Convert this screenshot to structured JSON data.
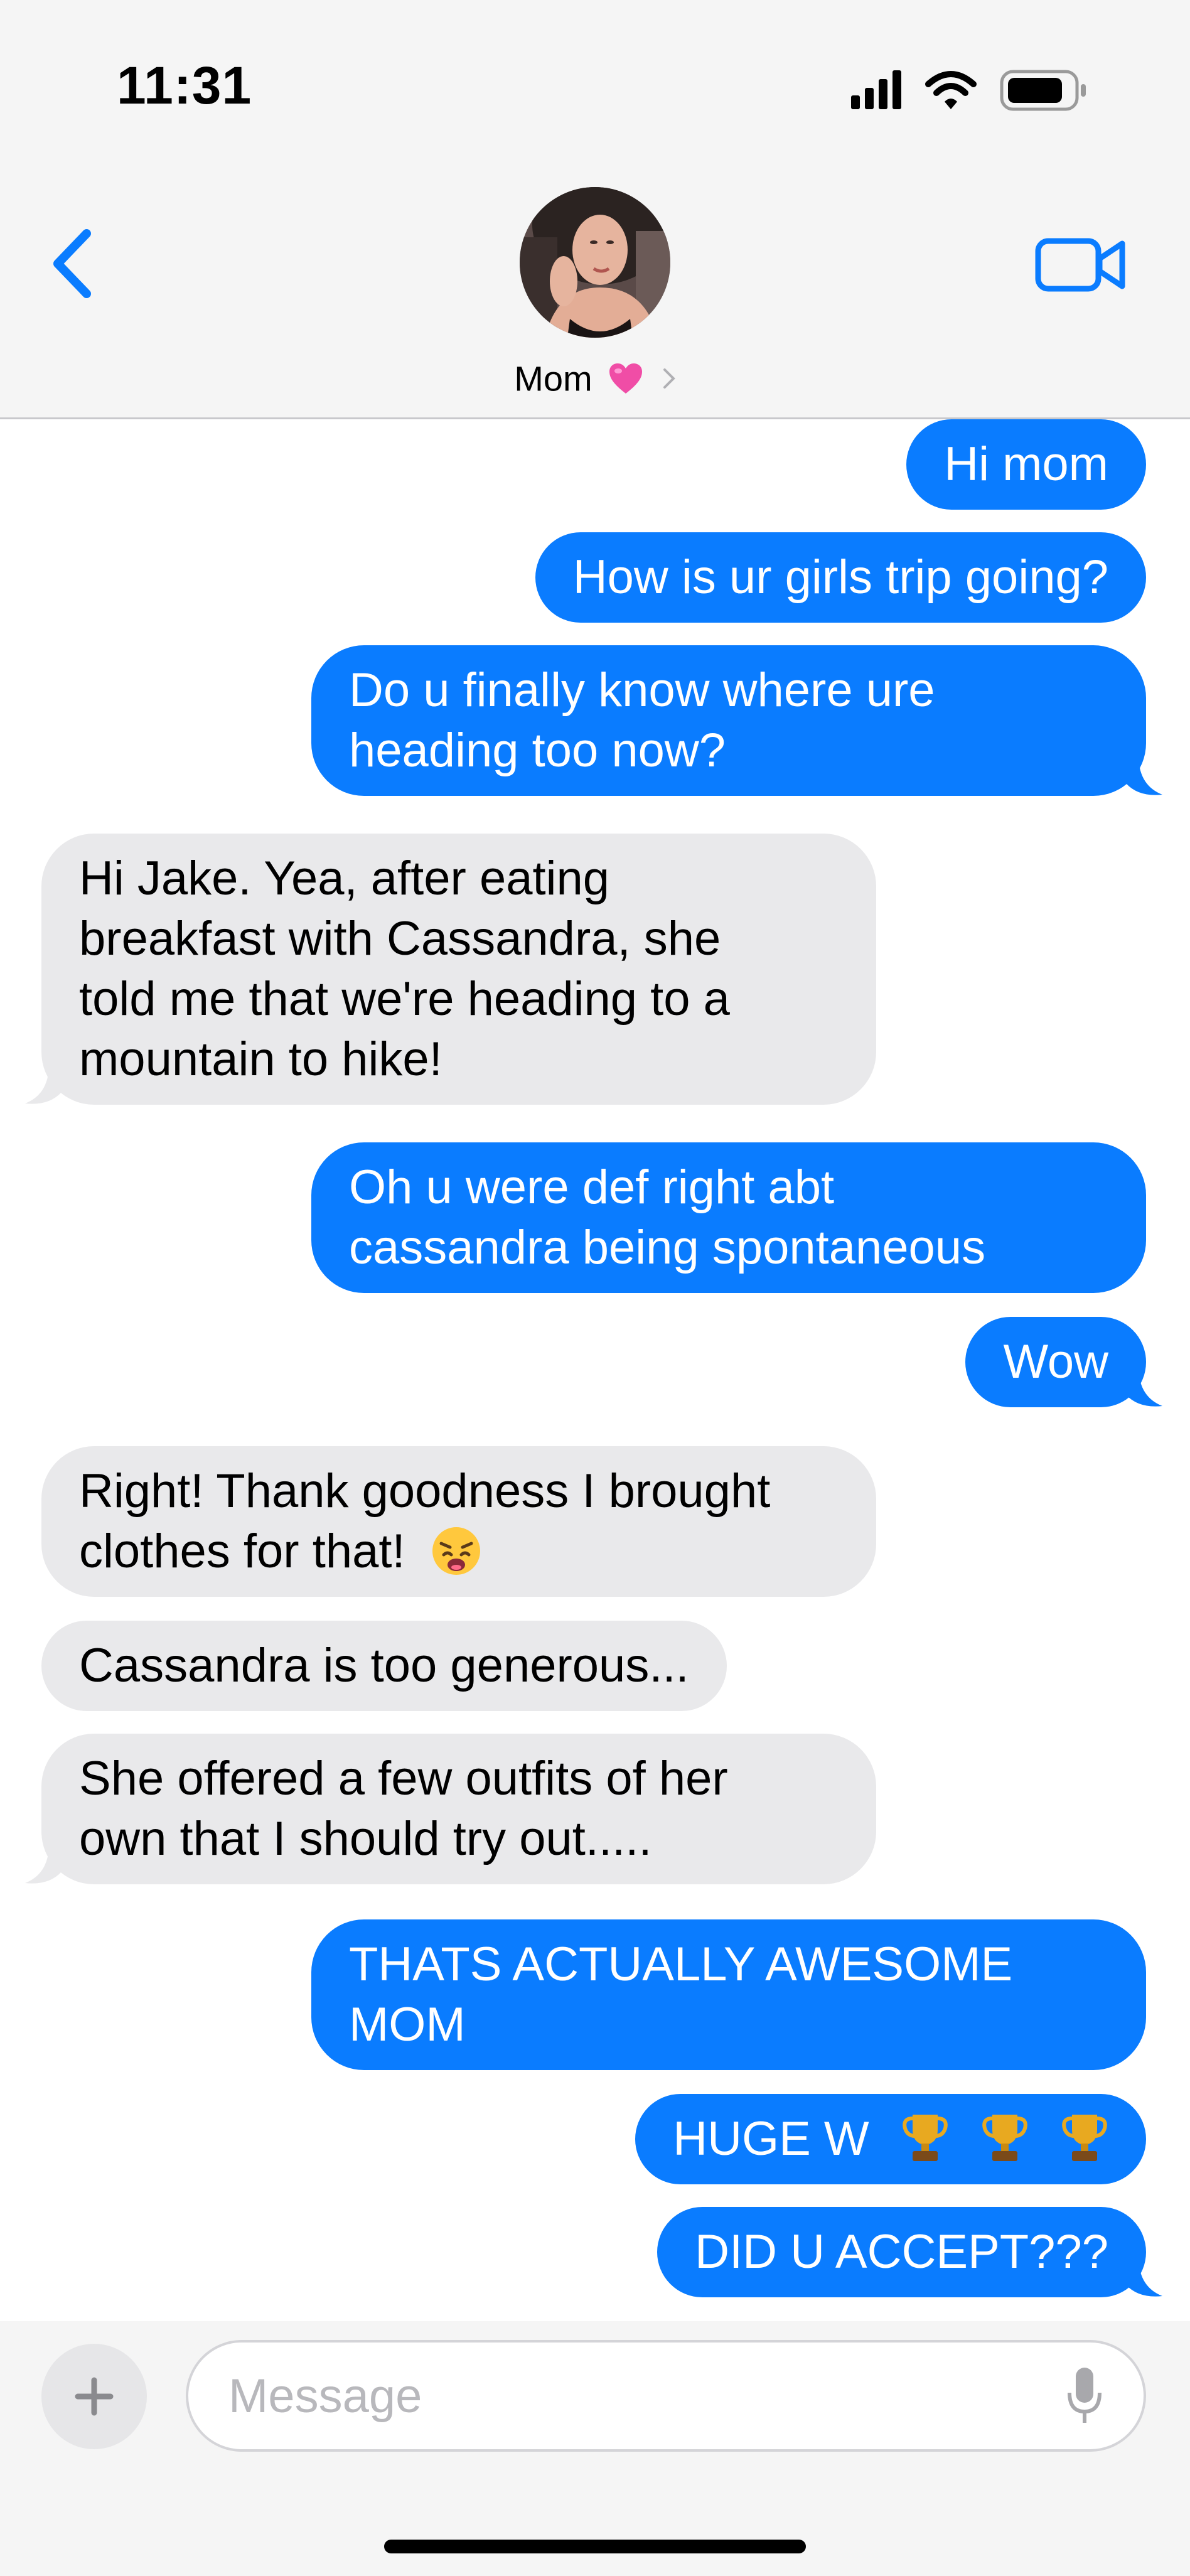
{
  "status_bar": {
    "time": "11:31"
  },
  "header": {
    "contact_name": "Mom",
    "contact_emoji": "heart-emoji",
    "back_icon": "chevron-left-icon",
    "video_icon": "video-camera-icon"
  },
  "messages": [
    {
      "from": "me",
      "lines": [
        "Hi mom"
      ]
    },
    {
      "from": "me",
      "lines": [
        "How is ur girls trip going?"
      ]
    },
    {
      "from": "me",
      "lines": [
        "Do u finally know where ure",
        "heading too now?"
      ]
    },
    {
      "from": "them",
      "lines": [
        "Hi Jake. Yea, after eating",
        "breakfast with Cassandra, she",
        "told me that we're heading to a",
        "mountain to hike!"
      ]
    },
    {
      "from": "me",
      "lines": [
        "Oh u were def right abt",
        "cassandra being spontaneous"
      ]
    },
    {
      "from": "me",
      "lines": [
        "Wow"
      ]
    },
    {
      "from": "them",
      "lines": [
        "Right! Thank goodness I brought",
        "clothes for that!"
      ],
      "emoji": "weary-face-emoji"
    },
    {
      "from": "them",
      "lines": [
        "Cassandra is too generous..."
      ]
    },
    {
      "from": "them",
      "lines": [
        "She offered a few outfits of her",
        "own that I should try out....."
      ]
    },
    {
      "from": "me",
      "lines": [
        "THATS ACTUALLY AWESOME",
        "MOM"
      ]
    },
    {
      "from": "me",
      "lines": [
        "HUGE W"
      ],
      "emoji": "trophy-emoji x3"
    },
    {
      "from": "me",
      "lines": [
        "DID U ACCEPT???"
      ]
    }
  ],
  "composer": {
    "placeholder": "Message",
    "plus_icon": "plus-icon",
    "mic_icon": "microphone-icon"
  },
  "colors": {
    "sent_bubble": "#0a7cff",
    "received_bubble": "#e9e9eb",
    "accent": "#0a7cff"
  }
}
